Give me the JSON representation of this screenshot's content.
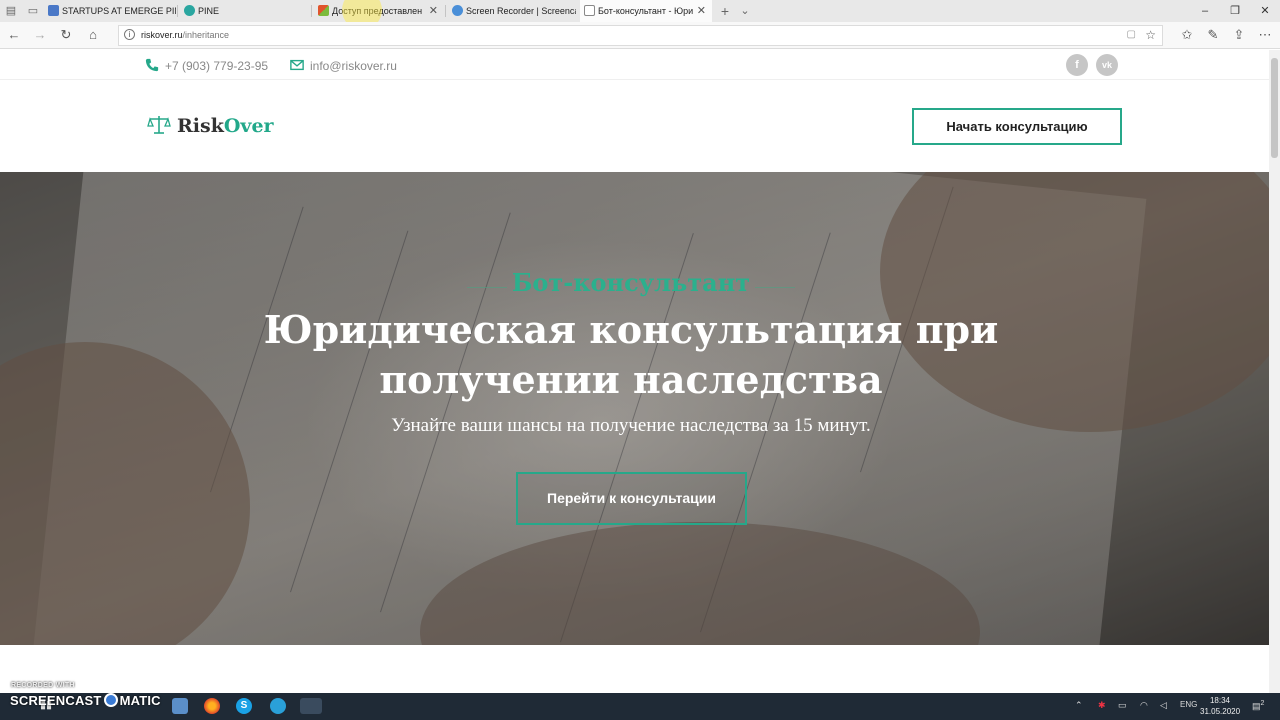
{
  "browser": {
    "tabs": [
      {
        "label": "STARTUPS AT EMERGE PINE",
        "favicon_color": "#4a78c7"
      },
      {
        "label": "PINE",
        "favicon_color": "#2aa6a0"
      },
      {
        "label": "Доступ предоставлен",
        "favicon_color": "#e0542c"
      },
      {
        "label": "Screen Recorder | Screencas",
        "favicon_color": "#4a8fd8"
      },
      {
        "label": "Бот-консультант - Юри",
        "favicon_color": "#888888"
      }
    ],
    "close_glyph": "✕",
    "new_tab_glyph": "+",
    "url_host": "riskover.ru",
    "url_path": "/inheritance"
  },
  "topline": {
    "phone": "+7 (903) 779-23-95",
    "email": "info@riskover.ru",
    "social": [
      {
        "label": "f",
        "icon": "facebook-icon"
      },
      {
        "label": "vk",
        "icon": "vk-icon"
      }
    ]
  },
  "header": {
    "logo_part1": "Risk",
    "logo_part2": "Over",
    "cta": "Начать консультацию"
  },
  "hero": {
    "kicker": "Бот-консультант",
    "title_line1": "Юридическая консультация при",
    "title_line2": "получении наследства",
    "subtitle": "Узнайте ваши шансы на получение наследства за 15 минут.",
    "cta": "Перейти к консультации"
  },
  "taskbar": {
    "recorded_with": "RECORDED WITH",
    "screencast_left": "SCREENCAST",
    "screencast_right": "MATIC",
    "language": "ENG",
    "time": "18:34",
    "date": "31.05.2020",
    "notification_count": "2"
  },
  "colors": {
    "accent": "#26a88a",
    "kicker_green": "#2bb08d",
    "taskbar": "#1f2a36"
  }
}
